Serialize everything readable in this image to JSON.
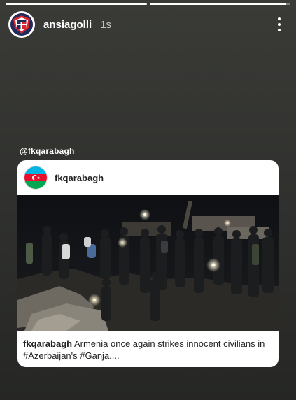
{
  "story": {
    "progress": [
      1.0,
      0.97
    ],
    "username": "ansiagolli",
    "time": "1s",
    "more_icon": "more-vertical-icon"
  },
  "mention": "@fkqarabagh",
  "shared_post": {
    "username": "fkqarabagh",
    "caption_user": "fkqarabagh",
    "caption_text": " Armenia once again strikes innocent civilians in #Azerbaijan's #Ganja...."
  },
  "colors": {
    "story_bg": "#33342f",
    "card_bg": "#ffffff",
    "text_dark": "#222222"
  }
}
